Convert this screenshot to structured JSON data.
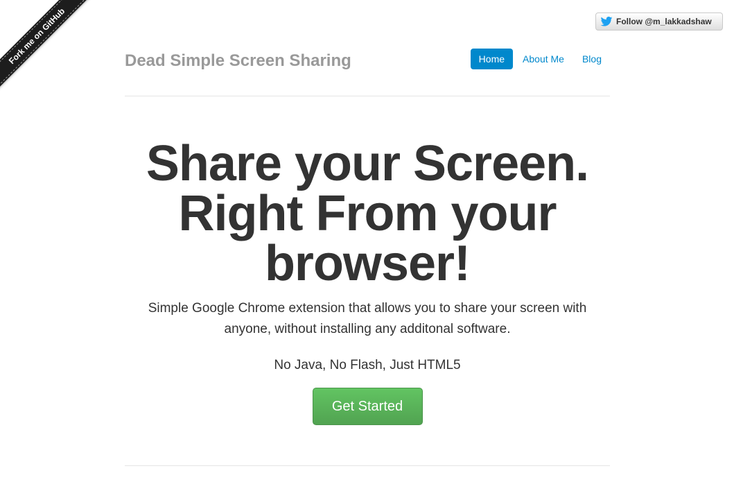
{
  "ribbon": {
    "label": "Fork me on GitHub"
  },
  "twitter": {
    "label": "Follow @m_lakkadshaw",
    "icon": "twitter-bird-icon",
    "color": "#1da1f2"
  },
  "header": {
    "brand": "Dead Simple Screen Sharing",
    "nav": [
      {
        "label": "Home",
        "active": true
      },
      {
        "label": "About Me",
        "active": false
      },
      {
        "label": "Blog",
        "active": false
      }
    ]
  },
  "hero": {
    "headline_lines": [
      "Share your Screen.",
      "Right From your",
      "browser!"
    ],
    "lead_lines": [
      "Simple Google Chrome extension that allows you to share your screen with",
      "anyone, without installing any additonal software."
    ],
    "sub": "No Java, No Flash, Just HTML5",
    "cta": "Get Started"
  },
  "colors": {
    "accent": "#0088cc",
    "cta": "#5bb75b",
    "brand": "#999999",
    "text": "#333333"
  }
}
